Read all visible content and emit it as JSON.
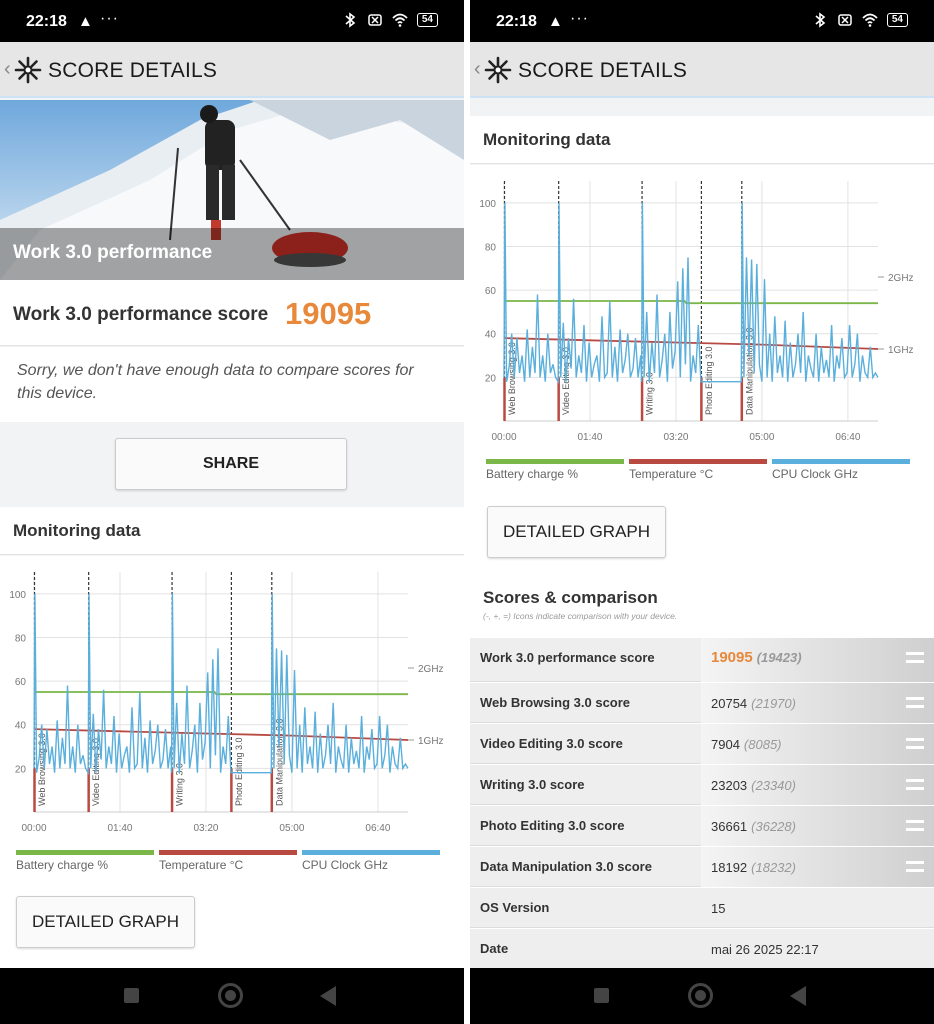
{
  "status": {
    "time": "22:18",
    "battery": "54"
  },
  "header": {
    "title": "SCORE DETAILS"
  },
  "left": {
    "hero_label": "Work 3.0 performance",
    "score_label": "Work 3.0 performance score",
    "score_value": "19095",
    "sorry_text": "Sorry, we don't have enough data to compare scores for this device.",
    "share_label": "SHARE",
    "monitoring_title": "Monitoring data",
    "detailed_graph_label": "DETAILED GRAPH"
  },
  "right": {
    "monitoring_title": "Monitoring data",
    "detailed_graph_label": "DETAILED GRAPH",
    "scores_title": "Scores & comparison",
    "scores_subtitle": "(-, +, =) Icons indicate comparison with your device.",
    "rows": [
      {
        "name": "Work 3.0 performance score",
        "value": "19095",
        "compare": "(19423)"
      },
      {
        "name": "Web Browsing 3.0 score",
        "value": "20754",
        "compare": "(21970)"
      },
      {
        "name": "Video Editing 3.0 score",
        "value": "7904",
        "compare": "(8085)"
      },
      {
        "name": "Writing 3.0 score",
        "value": "23203",
        "compare": "(23340)"
      },
      {
        "name": "Photo Editing 3.0 score",
        "value": "36661",
        "compare": "(36228)"
      },
      {
        "name": "Data Manipulation 3.0 score",
        "value": "18192",
        "compare": "(18232)"
      },
      {
        "name": "OS Version",
        "value": "15",
        "compare": ""
      },
      {
        "name": "Date",
        "value": "mai 26 2025 22:17",
        "compare": ""
      }
    ]
  },
  "chart_data": {
    "type": "line",
    "x_ticks": [
      "00:00",
      "01:40",
      "03:20",
      "05:00",
      "06:40"
    ],
    "x_tick_seconds": [
      0,
      100,
      200,
      300,
      400
    ],
    "xlim_seconds": [
      0,
      435
    ],
    "y_ticks": [
      20,
      40,
      60,
      80,
      100
    ],
    "ylim": [
      0,
      110
    ],
    "right_axis_ticks": [
      "1GHz",
      "2GHz"
    ],
    "segments": [
      {
        "label": "Web Browsing 3.0",
        "start_seconds": 0
      },
      {
        "label": "Video Editing 3.0",
        "start_seconds": 63
      },
      {
        "label": "Writing 3.0",
        "start_seconds": 160
      },
      {
        "label": "Photo Editing 3.0",
        "start_seconds": 229
      },
      {
        "label": "Data Manipulation 3.0",
        "start_seconds": 276
      }
    ],
    "series": [
      {
        "name": "Battery charge %",
        "color": "#7ab648",
        "x": [
          0,
          210,
          212,
          435
        ],
        "y": [
          55,
          55,
          54,
          54
        ]
      },
      {
        "name": "Temperature °C",
        "color": "#b94a42",
        "x": [
          0,
          100,
          200,
          300,
          435
        ],
        "y": [
          38,
          37,
          36,
          35,
          33
        ]
      },
      {
        "name": "CPU Clock GHz",
        "color": "#5aafdc",
        "x": [
          0,
          1,
          3,
          6,
          9,
          12,
          15,
          18,
          21,
          24,
          27,
          30,
          33,
          36,
          39,
          42,
          45,
          48,
          51,
          54,
          57,
          60,
          63,
          64,
          66,
          69,
          72,
          75,
          78,
          81,
          84,
          87,
          90,
          93,
          96,
          99,
          102,
          105,
          108,
          111,
          114,
          117,
          120,
          123,
          126,
          129,
          132,
          135,
          138,
          141,
          144,
          147,
          150,
          153,
          156,
          159,
          160,
          161,
          163,
          166,
          169,
          172,
          175,
          178,
          181,
          184,
          187,
          190,
          193,
          196,
          199,
          202,
          205,
          208,
          211,
          214,
          217,
          220,
          223,
          226,
          229,
          232,
          235,
          238,
          241,
          244,
          247,
          250,
          253,
          256,
          259,
          262,
          265,
          268,
          271,
          274,
          276,
          277,
          279,
          282,
          285,
          288,
          291,
          294,
          297,
          300,
          303,
          306,
          309,
          312,
          315,
          318,
          321,
          324,
          327,
          330,
          333,
          336,
          339,
          342,
          345,
          348,
          351,
          354,
          357,
          360,
          363,
          366,
          369,
          372,
          375,
          378,
          381,
          384,
          387,
          390,
          393,
          396,
          399,
          402,
          405,
          408,
          411,
          414,
          417,
          420,
          423,
          426,
          429,
          432,
          435
        ],
        "y": [
          20,
          100,
          18,
          25,
          40,
          20,
          38,
          22,
          30,
          18,
          42,
          20,
          34,
          22,
          58,
          20,
          30,
          18,
          40,
          22,
          26,
          20,
          18,
          100,
          20,
          45,
          18,
          38,
          24,
          56,
          20,
          30,
          22,
          44,
          18,
          36,
          20,
          26,
          30,
          18,
          48,
          20,
          22,
          55,
          20,
          34,
          18,
          42,
          22,
          28,
          40,
          20,
          24,
          38,
          20,
          30,
          18,
          100,
          20,
          50,
          18,
          36,
          22,
          58,
          20,
          28,
          40,
          18,
          50,
          24,
          32,
          64,
          20,
          70,
          26,
          75,
          18,
          30,
          22,
          44,
          18,
          18,
          18,
          18,
          18,
          18,
          18,
          18,
          18,
          18,
          18,
          18,
          18,
          18,
          18,
          18,
          18,
          100,
          20,
          75,
          30,
          74,
          22,
          72,
          26,
          18,
          65,
          20,
          40,
          18,
          48,
          22,
          30,
          20,
          46,
          18,
          36,
          20,
          26,
          40,
          22,
          50,
          18,
          30,
          24,
          20,
          40,
          18,
          34,
          22,
          28,
          20,
          44,
          18,
          30,
          24,
          38,
          20,
          22,
          44,
          20,
          26,
          40,
          18,
          30,
          22,
          20,
          34,
          20,
          22,
          20
        ]
      }
    ]
  }
}
